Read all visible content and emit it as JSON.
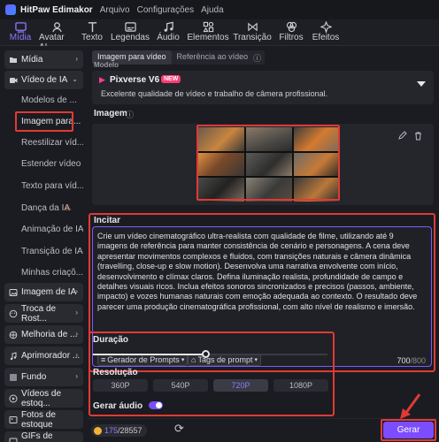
{
  "titlebar": {
    "app_name": "HitPaw Edimakor",
    "menu": [
      "Arquivo",
      "Configurações",
      "Ajuda"
    ]
  },
  "toolbar": {
    "items": [
      "Mídia",
      "Avatar AI",
      "Texto",
      "Legendas",
      "Áudio",
      "Elementos",
      "Transição",
      "Filtros",
      "Efeitos"
    ],
    "active": "Mídia"
  },
  "sidebar": {
    "midia": "Mídia",
    "video_ia": "Vídeo de IA",
    "sub_items": [
      "Modelos de ...",
      "Imagem para...",
      "Reestilizar víd...",
      "Estender vídeo",
      "Texto para víd...",
      "Dança da IA",
      "Animação de IA",
      "Transição de IA",
      "Minhas criaçõ..."
    ],
    "lower_items": [
      "Imagem de IA",
      "Troca de Rost...",
      "Melhoria de ...",
      "Aprimorador ...",
      "Fundo",
      "Vídeos de estoq...",
      "Fotos de estoque",
      "GIFs de estoque"
    ]
  },
  "main": {
    "tabs": [
      "Imagem para vídeo",
      "Referência ao vídeo"
    ],
    "model_section": "Modelo",
    "model_name": "Pixverse V6",
    "model_badge": "NEW",
    "model_desc": "Excelente qualidade de vídeo e trabalho de câmera profissional.",
    "image_label": "Imagem",
    "prompt_label": "Incitar",
    "prompt_text": "Crie um vídeo cinematográfico ultra-realista com qualidade de filme, utilizando até 9 imagens de referência para manter consistência de cenário e personagens. A cena deve apresentar movimentos complexos e fluidos, com transições naturais e câmera dinâmica (travelling, close-up e slow motion). Desenvolva uma narrativa envolvente com início, desenvolvimento e clímax claros. Defina iluminação realista, profundidade de campo e detalhes visuais ricos. Inclua efeitos sonoros sincronizados e precisos (passos, ambiente, impacto) e vozes humanas naturais com emoção adequada ao contexto. O resultado deve parecer uma produção cinematográfica profissional, com alto nível de realismo e imersão.",
    "prompt_gen": "Gerador de Prompts",
    "prompt_tags": "Tags de prompt",
    "char_count": "700",
    "char_max": "/800",
    "duration_label": "Duração",
    "duration_fraction": 0.48,
    "resolution_label": "Resolução",
    "resolutions": [
      "360P",
      "540P",
      "720P",
      "1080P"
    ],
    "active_resolution": "720P",
    "gen_audio_label": "Gerar áudio",
    "credits_used": "175",
    "credits_total": "/28557",
    "generate": "Gerar"
  },
  "colors": {
    "accent": "#8b7bff",
    "highlight": "#e03a35",
    "generate": "#7b4dff"
  }
}
